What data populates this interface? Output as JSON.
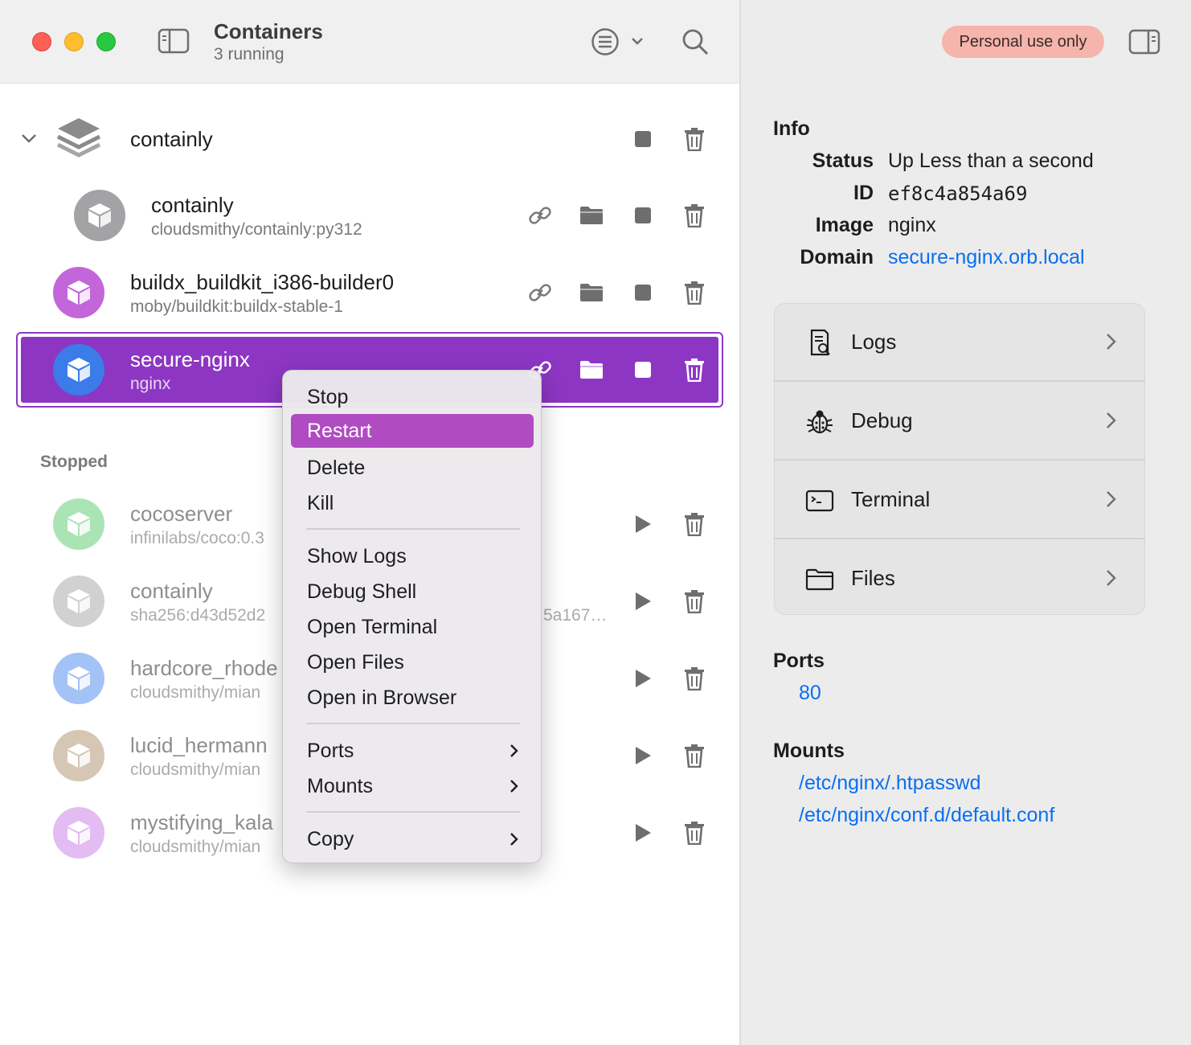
{
  "toolbar": {
    "title": "Containers",
    "subtitle": "3 running",
    "license_badge": "Personal use only"
  },
  "groups": [
    {
      "name": "containly",
      "expanded": true
    }
  ],
  "running": [
    {
      "name": "containly",
      "image": "cloudsmithy/containly:py312",
      "color": "#a3a3a5"
    },
    {
      "name": "buildx_buildkit_i386-builder0",
      "image": "moby/buildkit:buildx-stable-1",
      "color": "#c266d9"
    },
    {
      "name": "secure-nginx",
      "image": "nginx",
      "color": "#3b7bea",
      "selected": true
    }
  ],
  "stopped_label": "Stopped",
  "stopped": [
    {
      "name": "cocoserver",
      "image": "infinilabs/coco:0.3",
      "color": "#8fdc9c"
    },
    {
      "name": "containly",
      "image": "sha256:d43d52d2",
      "image_tail": "5a167…",
      "color": "#c6c6c8"
    },
    {
      "name": "hardcore_rhode",
      "image": "cloudsmithy/mian",
      "color": "#8db4f5"
    },
    {
      "name": "lucid_hermann",
      "image": "cloudsmithy/mian",
      "color": "#c7b59c"
    },
    {
      "name": "mystifying_kala",
      "image": "cloudsmithy/mian",
      "color": "#d9a6ee"
    }
  ],
  "context_menu": {
    "items": [
      "Stop",
      "Restart",
      "Delete",
      "Kill",
      "Show Logs",
      "Debug Shell",
      "Open Terminal",
      "Open Files",
      "Open in Browser",
      "Ports",
      "Mounts",
      "Copy"
    ],
    "highlighted": "Restart"
  },
  "info": {
    "heading": "Info",
    "status_label": "Status",
    "status_value": "Up Less than a second",
    "id_label": "ID",
    "id_value": "ef8c4a854a69",
    "image_label": "Image",
    "image_value": "nginx",
    "domain_label": "Domain",
    "domain_value": "secure-nginx.orb.local"
  },
  "actions": [
    "Logs",
    "Debug",
    "Terminal",
    "Files"
  ],
  "ports": {
    "heading": "Ports",
    "values": [
      "80"
    ]
  },
  "mounts": {
    "heading": "Mounts",
    "values": [
      "/etc/nginx/.htpasswd",
      "/etc/nginx/conf.d/default.conf"
    ]
  },
  "colors": {
    "accent": "#8d36c3",
    "menu_highlight": "#b04bc1",
    "link": "#0a6ff0",
    "badge": "#f5b4ac"
  }
}
